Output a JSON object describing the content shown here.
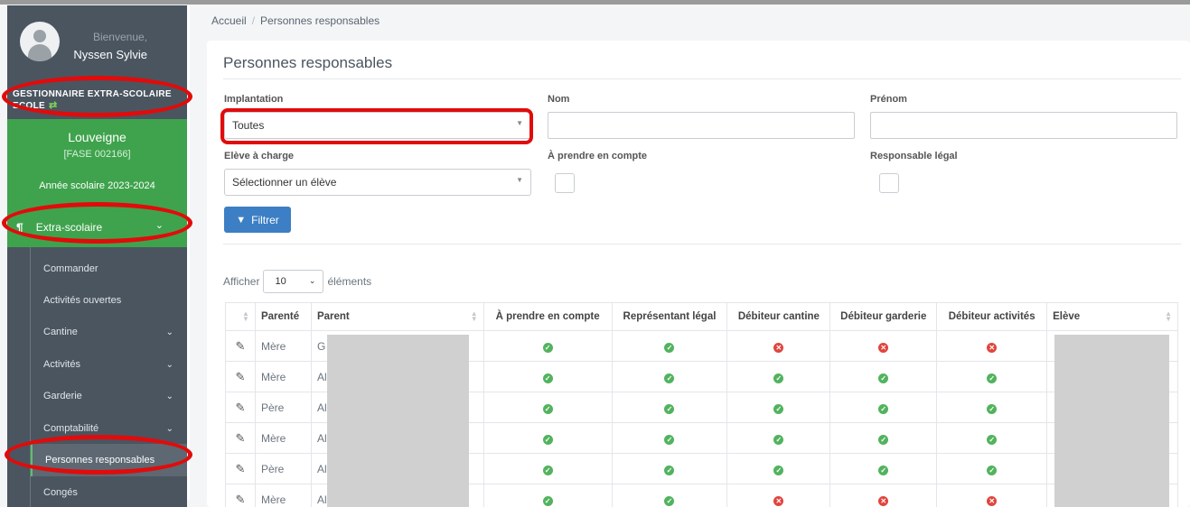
{
  "user": {
    "welcome": "Bienvenue,",
    "name": "Nyssen Sylvie"
  },
  "role": {
    "line1": "GESTIONNAIRE EXTRA-SCOLAIRE",
    "line2": "ECOLE",
    "swap_icon": "swap-arrows-icon"
  },
  "school": {
    "name": "Louveigne",
    "code": "[FASE 002166]",
    "year": "Année scolaire 2023-2024"
  },
  "menu": {
    "extra_label": "Extra-scolaire",
    "items": [
      {
        "label": "Commander",
        "has_children": false
      },
      {
        "label": "Activités ouvertes",
        "has_children": false
      },
      {
        "label": "Cantine",
        "has_children": true
      },
      {
        "label": "Activités",
        "has_children": true
      },
      {
        "label": "Garderie",
        "has_children": true
      },
      {
        "label": "Comptabilité",
        "has_children": true
      },
      {
        "label": "Personnes responsables",
        "has_children": false,
        "active": true
      },
      {
        "label": "Congés",
        "has_children": false
      }
    ]
  },
  "breadcrumb": {
    "home": "Accueil",
    "sep": "/",
    "current": "Personnes responsables"
  },
  "page": {
    "title": "Personnes responsables"
  },
  "filters": {
    "implantation_label": "Implantation",
    "implantation_value": "Toutes",
    "nom_label": "Nom",
    "prenom_label": "Prénom",
    "eleve_label": "Elève à charge",
    "eleve_placeholder": "Sélectionner un élève",
    "prendre_label": "À prendre en compte",
    "responsable_label": "Responsable légal",
    "filter_button": "Filtrer"
  },
  "length": {
    "prefix": "Afficher",
    "value": "10",
    "suffix": "éléments"
  },
  "table": {
    "headers": [
      "Parenté",
      "Parent",
      "À prendre en compte",
      "Représentant légal",
      "Débiteur cantine",
      "Débiteur garderie",
      "Débiteur activités",
      "Elève"
    ],
    "rows": [
      {
        "parente": "Mère",
        "parent": "G",
        "flags": [
          true,
          true,
          false,
          false,
          false
        ]
      },
      {
        "parente": "Mère",
        "parent": "Al",
        "flags": [
          true,
          true,
          true,
          true,
          true
        ]
      },
      {
        "parente": "Père",
        "parent": "Al",
        "flags": [
          true,
          true,
          true,
          true,
          true
        ]
      },
      {
        "parente": "Mère",
        "parent": "Al",
        "flags": [
          true,
          true,
          true,
          true,
          true
        ]
      },
      {
        "parente": "Père",
        "parent": "Al",
        "flags": [
          true,
          true,
          true,
          true,
          true
        ]
      },
      {
        "parente": "Mère",
        "parent": "Al",
        "flags": [
          true,
          true,
          false,
          false,
          false
        ]
      }
    ]
  },
  "colors": {
    "sidebar": "#4a5560",
    "green": "#3fa34d",
    "button": "#3d7fc4",
    "highlight": "#e10b0b",
    "ok": "#52b35e",
    "ko": "#e0453d"
  }
}
